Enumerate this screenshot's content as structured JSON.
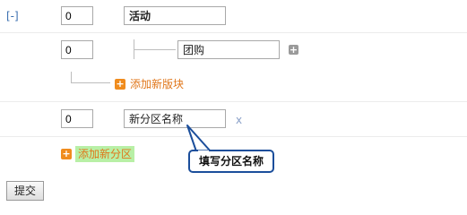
{
  "section": {
    "collapse_label": "[-]",
    "order": "0",
    "name": "活动"
  },
  "block": {
    "order": "0",
    "name": "团购"
  },
  "add_block_label": "添加新版块",
  "new_section": {
    "order": "0",
    "name": "新分区名称",
    "delete_label": "x"
  },
  "add_section_label": "添加新分区",
  "tooltip_text": "填写分区名称",
  "submit_label": "提交",
  "icons": {
    "add_block_inline": "plus-square-icon",
    "add_block": "plus-square-icon",
    "add_section": "plus-square-icon",
    "delete": "close-icon"
  },
  "colors": {
    "accent_orange": "#f08c1e",
    "link_orange": "#e0761a",
    "highlight_green": "#b8f0a6",
    "tooltip_border": "#1b4e9b"
  }
}
